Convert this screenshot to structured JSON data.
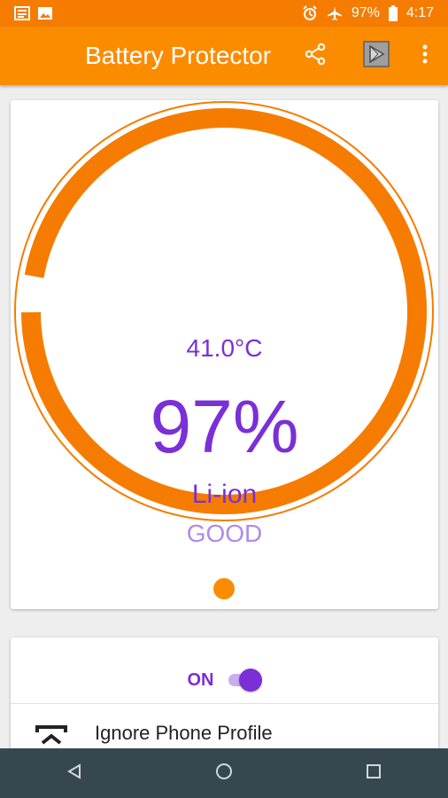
{
  "status_bar": {
    "battery_text": "97%",
    "time": "4:17",
    "icons": [
      "news-icon",
      "image-icon",
      "alarm-icon",
      "airplane-icon",
      "battery-icon"
    ]
  },
  "app_bar": {
    "title": "Battery Protector",
    "actions": [
      "share-icon",
      "play-store-icon",
      "more-vert-icon"
    ]
  },
  "gauge": {
    "temperature": "41.0°C",
    "level_text": "97%",
    "level_percent": 97,
    "technology": "Li-ion",
    "health": "GOOD"
  },
  "toggle": {
    "label": "ON",
    "checked": true
  },
  "settings": {
    "profile_label": "Ignore Phone Profile"
  },
  "colors": {
    "accent_orange": "#fb8c00",
    "status_orange": "#f57c00",
    "purple": "#7b2fd6",
    "purple_light": "#b08be8",
    "nav_bar": "#37474f"
  },
  "nav_bar": {
    "buttons": [
      "back-icon",
      "home-icon",
      "recents-icon"
    ]
  }
}
